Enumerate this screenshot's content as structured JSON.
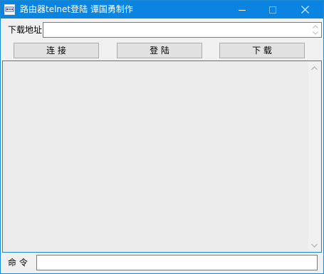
{
  "window": {
    "title": "路由器telnet登陆   谭国勇制作"
  },
  "controls": {
    "minimize_icon": "minimize-icon",
    "maximize_icon": "maximize-icon",
    "close_icon": "close-icon"
  },
  "form": {
    "url_label": "下载地址",
    "url_value": "",
    "command_label": "命 令",
    "command_value": ""
  },
  "buttons": {
    "connect": "连        接",
    "login": "登        陆",
    "download": "下        载"
  },
  "output": {
    "text": ""
  },
  "colors": {
    "titlebar": "#0a84e0",
    "accent_border": "#1a8ad4",
    "window_bg": "#f0f0f0",
    "output_bg": "#ececec"
  }
}
